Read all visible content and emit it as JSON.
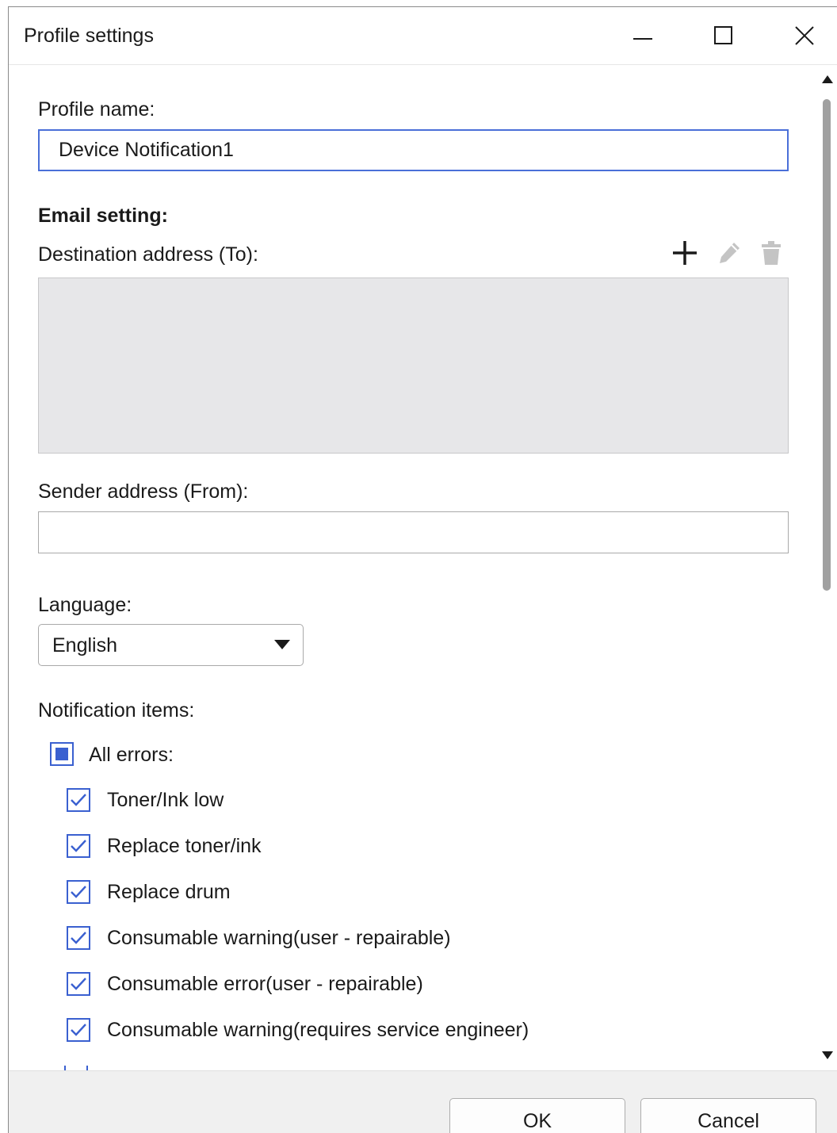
{
  "window": {
    "title": "Profile settings"
  },
  "profile": {
    "label": "Profile name:",
    "value": "Device Notification1"
  },
  "email": {
    "heading": "Email setting:",
    "destination_label": "Destination address (To):",
    "destination_items": [],
    "sender_label": "Sender address (From):",
    "sender_value": ""
  },
  "language": {
    "label": "Language:",
    "selected": "English"
  },
  "notifications": {
    "label": "Notification items:",
    "all_errors": {
      "label": "All errors:",
      "state": "partial"
    },
    "items": [
      {
        "label": "Toner/Ink low",
        "checked": true
      },
      {
        "label": "Replace toner/ink",
        "checked": true
      },
      {
        "label": "Replace drum",
        "checked": true
      },
      {
        "label": "Consumable warning(user - repairable)",
        "checked": true
      },
      {
        "label": "Consumable error(user - repairable)",
        "checked": true
      },
      {
        "label": "Consumable warning(requires service engineer)",
        "checked": true
      }
    ]
  },
  "buttons": {
    "ok": "OK",
    "cancel": "Cancel"
  },
  "colors": {
    "accent": "#3a60d0",
    "focus_border": "#4a6fd8",
    "list_background": "#e7e7e9",
    "footer_background": "#f0f0f0"
  }
}
